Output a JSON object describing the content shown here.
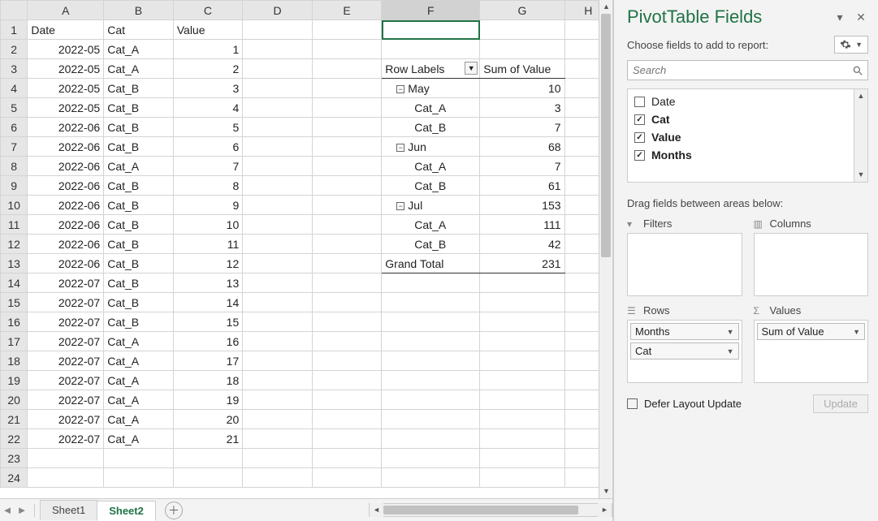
{
  "grid": {
    "columns": [
      "A",
      "B",
      "C",
      "D",
      "E",
      "F",
      "G",
      "H"
    ],
    "headers": {
      "A": "Date",
      "B": "Cat",
      "C": "Value"
    },
    "rows": [
      {
        "n": 1
      },
      {
        "n": 2,
        "A": "2022-05",
        "B": "Cat_A",
        "C": "1"
      },
      {
        "n": 3,
        "A": "2022-05",
        "B": "Cat_A",
        "C": "2"
      },
      {
        "n": 4,
        "A": "2022-05",
        "B": "Cat_B",
        "C": "3"
      },
      {
        "n": 5,
        "A": "2022-05",
        "B": "Cat_B",
        "C": "4"
      },
      {
        "n": 6,
        "A": "2022-06",
        "B": "Cat_B",
        "C": "5"
      },
      {
        "n": 7,
        "A": "2022-06",
        "B": "Cat_B",
        "C": "6"
      },
      {
        "n": 8,
        "A": "2022-06",
        "B": "Cat_A",
        "C": "7"
      },
      {
        "n": 9,
        "A": "2022-06",
        "B": "Cat_B",
        "C": "8"
      },
      {
        "n": 10,
        "A": "2022-06",
        "B": "Cat_B",
        "C": "9"
      },
      {
        "n": 11,
        "A": "2022-06",
        "B": "Cat_B",
        "C": "10"
      },
      {
        "n": 12,
        "A": "2022-06",
        "B": "Cat_B",
        "C": "11"
      },
      {
        "n": 13,
        "A": "2022-06",
        "B": "Cat_B",
        "C": "12"
      },
      {
        "n": 14,
        "A": "2022-07",
        "B": "Cat_B",
        "C": "13"
      },
      {
        "n": 15,
        "A": "2022-07",
        "B": "Cat_B",
        "C": "14"
      },
      {
        "n": 16,
        "A": "2022-07",
        "B": "Cat_B",
        "C": "15"
      },
      {
        "n": 17,
        "A": "2022-07",
        "B": "Cat_A",
        "C": "16"
      },
      {
        "n": 18,
        "A": "2022-07",
        "B": "Cat_A",
        "C": "17"
      },
      {
        "n": 19,
        "A": "2022-07",
        "B": "Cat_A",
        "C": "18"
      },
      {
        "n": 20,
        "A": "2022-07",
        "B": "Cat_A",
        "C": "19"
      },
      {
        "n": 21,
        "A": "2022-07",
        "B": "Cat_A",
        "C": "20"
      },
      {
        "n": 22,
        "A": "2022-07",
        "B": "Cat_A",
        "C": "21"
      },
      {
        "n": 23
      },
      {
        "n": 24
      }
    ]
  },
  "pivot": {
    "row_labels_hdr": "Row Labels",
    "value_hdr": "Sum of Value",
    "rows": [
      {
        "level": 1,
        "label": "May",
        "collapse": true,
        "value": "10"
      },
      {
        "level": 2,
        "label": "Cat_A",
        "value": "3"
      },
      {
        "level": 2,
        "label": "Cat_B",
        "value": "7"
      },
      {
        "level": 1,
        "label": "Jun",
        "collapse": true,
        "value": "68"
      },
      {
        "level": 2,
        "label": "Cat_A",
        "value": "7"
      },
      {
        "level": 2,
        "label": "Cat_B",
        "value": "61"
      },
      {
        "level": 1,
        "label": "Jul",
        "collapse": true,
        "value": "153"
      },
      {
        "level": 2,
        "label": "Cat_A",
        "value": "111"
      },
      {
        "level": 2,
        "label": "Cat_B",
        "value": "42"
      }
    ],
    "grand_total_label": "Grand Total",
    "grand_total_value": "231"
  },
  "tabs": {
    "sheets": [
      "Sheet1",
      "Sheet2"
    ],
    "active": "Sheet2"
  },
  "pane": {
    "title": "PivotTable Fields",
    "choose_label": "Choose fields to add to report:",
    "search_placeholder": "Search",
    "fields": [
      {
        "label": "Date",
        "checked": false,
        "bold": false
      },
      {
        "label": "Cat",
        "checked": true,
        "bold": true
      },
      {
        "label": "Value",
        "checked": true,
        "bold": true
      },
      {
        "label": "Months",
        "checked": true,
        "bold": true
      }
    ],
    "drag_label": "Drag fields between areas below:",
    "areas": {
      "filters": {
        "label": "Filters",
        "items": []
      },
      "columns": {
        "label": "Columns",
        "items": []
      },
      "rows": {
        "label": "Rows",
        "items": [
          "Months",
          "Cat"
        ]
      },
      "values": {
        "label": "Values",
        "items": [
          "Sum of Value"
        ]
      }
    },
    "defer_label": "Defer Layout Update",
    "update_label": "Update"
  }
}
